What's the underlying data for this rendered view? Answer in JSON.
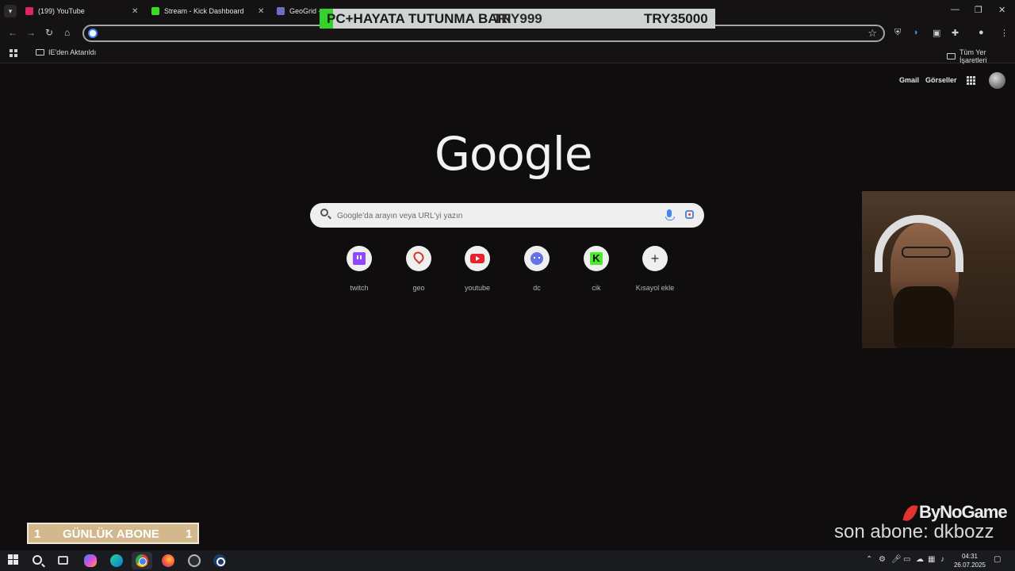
{
  "tabs": [
    {
      "label": "(199) YouTube",
      "favicon": "youtube-icon"
    },
    {
      "label": "Stream - Kick Dashboard",
      "favicon": "kick-icon"
    },
    {
      "label": "GeoGrid -",
      "favicon": "geogrid-icon"
    }
  ],
  "donation_bar": {
    "text": "PC+HAYATA TUTUNMA BARI",
    "amount_current": "TRY999",
    "amount_goal": "TRY35000",
    "accent_color": "#35d22c"
  },
  "toolbar": {
    "address_value": ""
  },
  "bookmarks": {
    "imported_label": "IE'den Aktarıldı",
    "all_label": "Tüm Yer İşaretleri"
  },
  "google": {
    "gmail": "Gmail",
    "images": "Görseller",
    "logo": "Google",
    "search_placeholder": "Google'da arayın veya URL'yi yazın",
    "shortcuts": [
      {
        "label": "twitch",
        "icon": "twitch-icon"
      },
      {
        "label": "geo",
        "icon": "map-pin-icon"
      },
      {
        "label": "youtube",
        "icon": "youtube-icon"
      },
      {
        "label": "dc",
        "icon": "discord-icon"
      },
      {
        "label": "cik",
        "icon": "kick-icon"
      },
      {
        "label": "Kısayol ekle",
        "icon": "plus-icon"
      }
    ]
  },
  "overlay": {
    "daily_subs_left": "1",
    "daily_subs_label": "GÜNLÜK ABONE",
    "daily_subs_right": "1",
    "sponsor": "ByNoGame",
    "last_sub": "son abone: dkbozz"
  },
  "taskbar": {
    "time": "04:31",
    "date": "26.07.2025"
  }
}
